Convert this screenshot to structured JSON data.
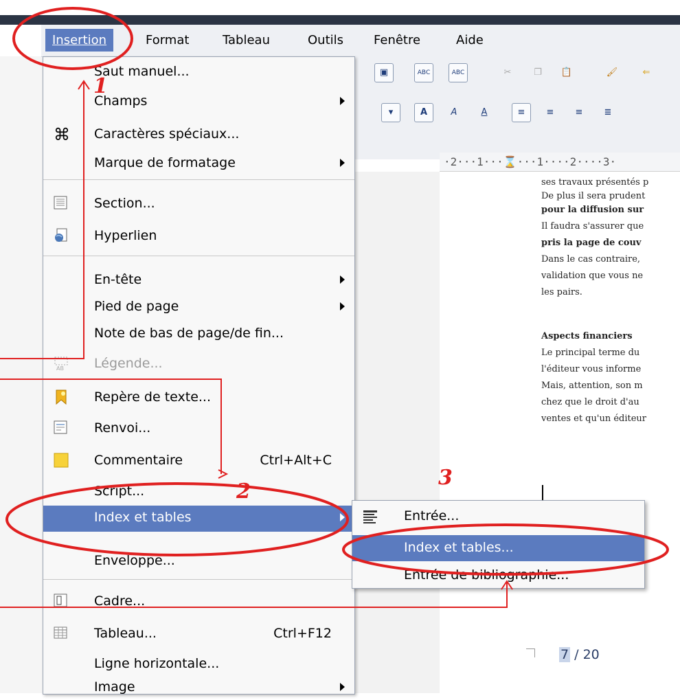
{
  "menubar": {
    "items": [
      {
        "label": "Insertion",
        "active": true
      },
      {
        "label": "Format"
      },
      {
        "label": "Tableau"
      },
      {
        "label": "Outils"
      },
      {
        "label": "Fenêtre"
      },
      {
        "label": "Aide"
      }
    ]
  },
  "ruler": {
    "text": "·2···1···⌛···1····2····3·"
  },
  "insert_menu": {
    "items": [
      {
        "label": "Saut manuel...",
        "icon": "none"
      },
      {
        "label": "Champs",
        "submenu": true
      },
      {
        "label": "Caractères spéciaux...",
        "icon": "command-icon"
      },
      {
        "label": "Marque de formatage",
        "submenu": true
      },
      {
        "label": "Section...",
        "icon": "section-icon"
      },
      {
        "label": "Hyperlien",
        "icon": "hyperlink-icon"
      },
      {
        "label": "En-tête",
        "submenu": true
      },
      {
        "label": "Pied de page",
        "submenu": true
      },
      {
        "label": "Note de bas de page/de fin..."
      },
      {
        "label": "Légende...",
        "icon": "caption-icon",
        "disabled": true
      },
      {
        "label": "Repère de texte...",
        "icon": "bookmark-icon"
      },
      {
        "label": "Renvoi...",
        "icon": "cross-reference-icon"
      },
      {
        "label": "Commentaire",
        "shortcut": "Ctrl+Alt+C",
        "icon": "comment-icon"
      },
      {
        "label": "Script..."
      },
      {
        "label": "Index et tables",
        "submenu": true,
        "highlighted": true
      },
      {
        "label": "Enveloppe..."
      },
      {
        "label": "Cadre...",
        "icon": "frame-icon"
      },
      {
        "label": "Tableau...",
        "shortcut": "Ctrl+F12",
        "icon": "table-icon"
      },
      {
        "label": "Ligne horizontale..."
      },
      {
        "label": "Image",
        "submenu": true
      }
    ]
  },
  "index_submenu": {
    "items": [
      {
        "label": "Entrée...",
        "icon": "index-entry-icon"
      },
      {
        "label": "Index et tables...",
        "highlighted": true
      },
      {
        "label": "Entrée de bibliographie..."
      }
    ]
  },
  "document": {
    "lines": [
      {
        "text": "ses travaux présentés p",
        "bold": false
      },
      {
        "text": "De plus il sera prudent",
        "bold": false
      },
      {
        "text": "pour la diffusion sur",
        "bold": true
      },
      {
        "text": "Il faudra s'assurer que",
        "bold": false
      },
      {
        "text": "pris la page de couv",
        "bold": true
      },
      {
        "text": "Dans le cas contraire,",
        "bold": false
      },
      {
        "text": "validation que vous ne",
        "bold": false
      },
      {
        "text": "les pairs.",
        "bold": false
      },
      {
        "text": "Aspects financiers",
        "bold": true
      },
      {
        "text": "Le principal terme du",
        "bold": false
      },
      {
        "text": "l'éditeur vous informe",
        "bold": false
      },
      {
        "text": "Mais, attention, son m",
        "bold": false
      },
      {
        "text": "chez que le droit d'au",
        "bold": false
      },
      {
        "text": "ventes et qu'un éditeur",
        "bold": false
      }
    ],
    "page_current": "7",
    "page_total": " / 20"
  },
  "annotations": {
    "step1": "1",
    "step2": "2",
    "step3": "3",
    "accent": "#e02020"
  },
  "colors": {
    "highlight": "#5b7bbf",
    "menu_bg": "#f8f8f8",
    "toolbar_bg": "#eef0f4"
  }
}
